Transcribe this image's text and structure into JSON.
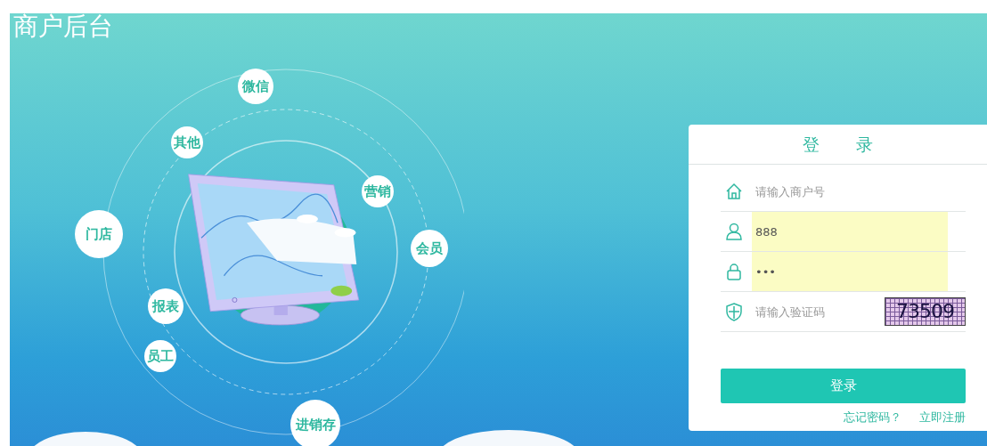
{
  "title": "商户后台",
  "modules": [
    {
      "label": "微信"
    },
    {
      "label": "其他"
    },
    {
      "label": "营销"
    },
    {
      "label": "门店"
    },
    {
      "label": "会员"
    },
    {
      "label": "报表"
    },
    {
      "label": "员工"
    },
    {
      "label": "进销存"
    }
  ],
  "login": {
    "title": "登录",
    "fields": [
      {
        "kind": "merchant",
        "placeholder": "请输入商户号",
        "autofilled": false
      },
      {
        "kind": "user",
        "value": "888",
        "autofilled": true
      },
      {
        "kind": "password",
        "value": "•••",
        "autofilled": true
      },
      {
        "kind": "captcha",
        "placeholder": "请输入验证码",
        "autofilled": false,
        "captcha_text": "73509"
      }
    ],
    "submit": "登录",
    "links": [
      "忘记密码？",
      "立即注册"
    ]
  }
}
